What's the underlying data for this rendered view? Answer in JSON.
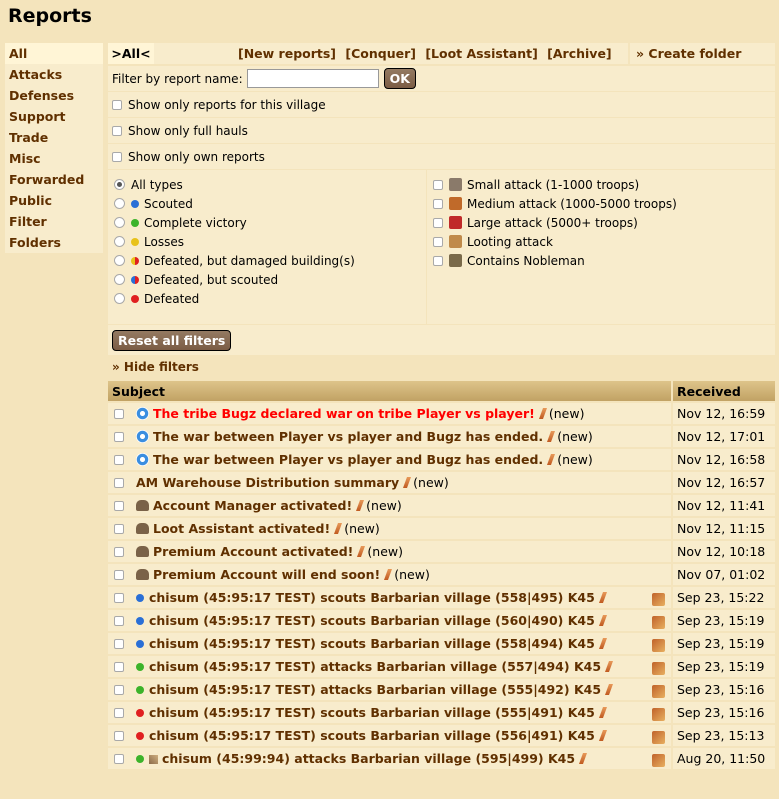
{
  "page_title": "Reports",
  "sidebar": [
    {
      "label": "All",
      "active": true
    },
    {
      "label": "Attacks"
    },
    {
      "label": "Defenses"
    },
    {
      "label": "Support"
    },
    {
      "label": "Trade"
    },
    {
      "label": "Misc"
    },
    {
      "label": "Forwarded"
    },
    {
      "label": "Public"
    },
    {
      "label": "Filter"
    },
    {
      "label": "Folders"
    }
  ],
  "topbar": {
    "all": ">All<",
    "links": [
      "[New reports]",
      "[Conquer]",
      "[Loot Assistant]",
      "[Archive]"
    ],
    "create_folder": "» Create folder"
  },
  "filters": {
    "name_label": "Filter by report name:",
    "name_value": "",
    "ok": "OK",
    "checks": [
      "Show only reports for this village",
      "Show only full hauls",
      "Show only own reports"
    ],
    "types": [
      {
        "label": "All types",
        "color": "",
        "selected": true
      },
      {
        "label": "Scouted",
        "color": "#2a6fd6"
      },
      {
        "label": "Complete victory",
        "color": "#3cb32a"
      },
      {
        "label": "Losses",
        "color": "#e8c21a"
      },
      {
        "label": "Defeated, but damaged building(s)",
        "color": "half-yr"
      },
      {
        "label": "Defeated, but scouted",
        "color": "half-br"
      },
      {
        "label": "Defeated",
        "color": "#e02020"
      }
    ],
    "units": [
      {
        "label": "Small attack (1-1000 troops)",
        "icon": "small-attack-icon",
        "color": "#8a7a6a"
      },
      {
        "label": "Medium attack (1000-5000 troops)",
        "icon": "medium-attack-icon",
        "color": "#c06a2a"
      },
      {
        "label": "Large attack (5000+ troops)",
        "icon": "large-attack-icon",
        "color": "#c02a2a"
      },
      {
        "label": "Looting attack",
        "icon": "looting-attack-icon",
        "color": "#c08a4a"
      },
      {
        "label": "Contains Nobleman",
        "icon": "nobleman-icon",
        "color": "#7a6a4a"
      }
    ],
    "reset": "Reset all filters",
    "hide": "» Hide filters"
  },
  "table": {
    "col_subject": "Subject",
    "col_received": "Received",
    "rows": [
      {
        "icon": "gear",
        "title": "The tribe Bugz declared war on tribe Player vs player!",
        "red": true,
        "new": "(new)",
        "date": "Nov 12, 16:59"
      },
      {
        "icon": "gear",
        "title": "The war between Player vs player and Bugz has ended.",
        "new": "(new)",
        "date": "Nov 12, 17:01"
      },
      {
        "icon": "gear",
        "title": "The war between Player vs player and Bugz has ended.",
        "new": "(new)",
        "date": "Nov 12, 16:58"
      },
      {
        "icon": "",
        "title": "AM Warehouse Distribution summary",
        "new": "(new)",
        "date": "Nov 12, 16:57"
      },
      {
        "icon": "am",
        "title": "Account Manager activated!",
        "new": "(new)",
        "date": "Nov 12, 11:41"
      },
      {
        "icon": "am",
        "title": "Loot Assistant activated!",
        "new": "(new)",
        "date": "Nov 12, 11:15"
      },
      {
        "icon": "am",
        "title": "Premium Account activated!",
        "new": "(new)",
        "date": "Nov 12, 10:18"
      },
      {
        "icon": "am",
        "title": "Premium Account will end soon!",
        "new": "(new)",
        "date": "Nov 07, 01:02"
      },
      {
        "icon": "dot",
        "dot": "#2a6fd6",
        "title": "chisum (45:95:17 TEST) scouts Barbarian village (558|495) K45",
        "village": true,
        "date": "Sep 23, 15:22"
      },
      {
        "icon": "dot",
        "dot": "#2a6fd6",
        "title": "chisum (45:95:17 TEST) scouts Barbarian village (560|490) K45",
        "village": true,
        "date": "Sep 23, 15:19"
      },
      {
        "icon": "dot",
        "dot": "#2a6fd6",
        "title": "chisum (45:95:17 TEST) scouts Barbarian village (558|494) K45",
        "village": true,
        "date": "Sep 23, 15:19"
      },
      {
        "icon": "dot",
        "dot": "#3cb32a",
        "title": "chisum (45:95:17 TEST) attacks Barbarian village (557|494) K45",
        "village": true,
        "date": "Sep 23, 15:19"
      },
      {
        "icon": "dot",
        "dot": "#3cb32a",
        "title": "chisum (45:95:17 TEST) attacks Barbarian village (555|492) K45",
        "village": true,
        "date": "Sep 23, 15:16"
      },
      {
        "icon": "dot",
        "dot": "#e02020",
        "title": "chisum (45:95:17 TEST) scouts Barbarian village (555|491) K45",
        "village": true,
        "date": "Sep 23, 15:16"
      },
      {
        "icon": "dot",
        "dot": "#e02020",
        "title": "chisum (45:95:17 TEST) scouts Barbarian village (556|491) K45",
        "village": true,
        "date": "Sep 23, 15:13"
      },
      {
        "icon": "dot2",
        "dot": "#3cb32a",
        "title": "chisum (45:99:94) attacks Barbarian village (595|499) K45",
        "village": true,
        "date": "Aug 20, 11:50"
      }
    ]
  }
}
